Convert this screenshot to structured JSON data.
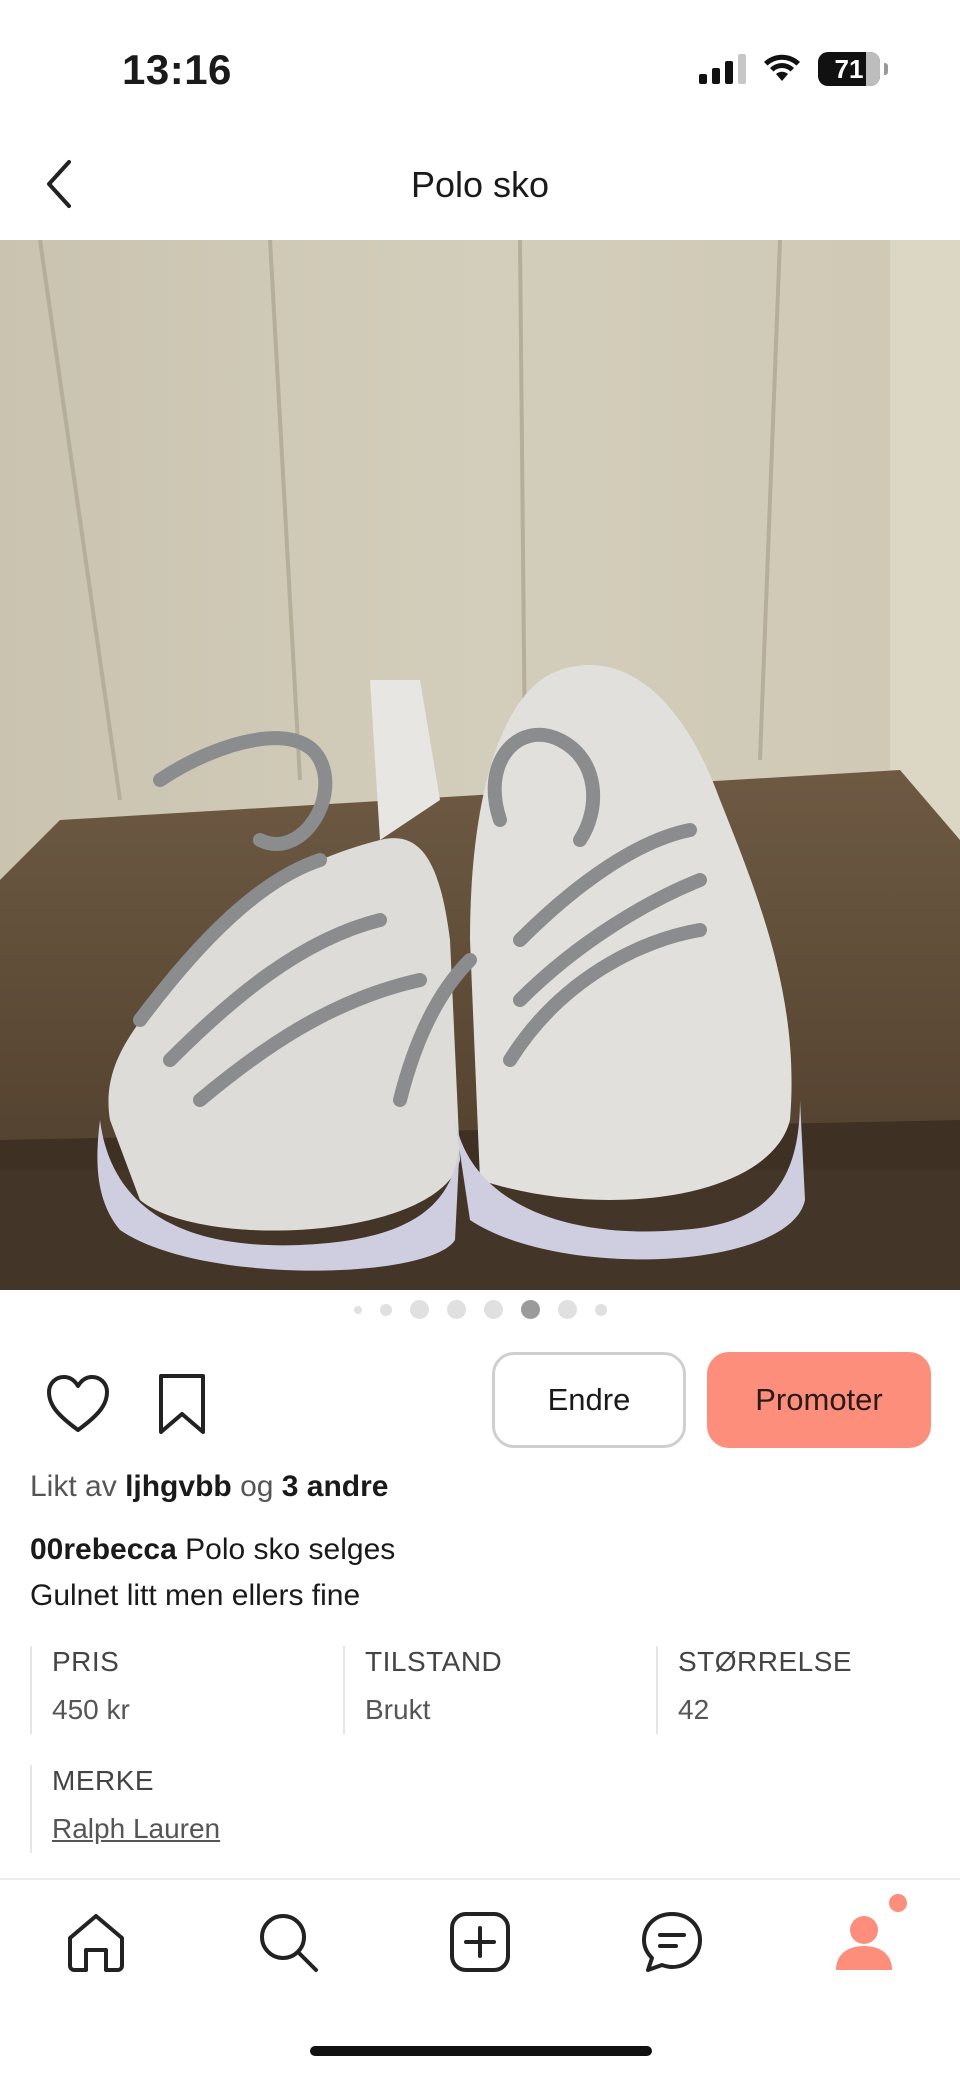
{
  "status_bar": {
    "time": "13:16",
    "battery": "71"
  },
  "header": {
    "title": "Polo sko"
  },
  "photo": {
    "alt": "Polo sko",
    "pager": {
      "count": 7,
      "active_index": 4
    }
  },
  "actions": {
    "edit_label": "Endre",
    "promote_label": "Promoter"
  },
  "likes": {
    "prefix": "Likt av",
    "user": "ljhgvbb",
    "joiner": "og",
    "others": "3 andre"
  },
  "caption": {
    "username": "00rebecca",
    "title": "Polo sko selges",
    "description": "Gulnet litt men ellers fine"
  },
  "details": {
    "price": {
      "label": "PRIS",
      "value": "450 kr"
    },
    "condition": {
      "label": "TILSTAND",
      "value": "Brukt"
    },
    "size": {
      "label": "STØRRELSE",
      "value": "42"
    },
    "brand": {
      "label": "MERKE",
      "value": "Ralph Lauren"
    }
  },
  "tabbar": {
    "items": [
      "home-icon",
      "search-icon",
      "add-icon",
      "messages-icon",
      "profile-icon"
    ],
    "accent": "#fd8e7b"
  },
  "colors": {
    "promote_button": "#fd8e7b",
    "border": "#cfcfcf"
  }
}
